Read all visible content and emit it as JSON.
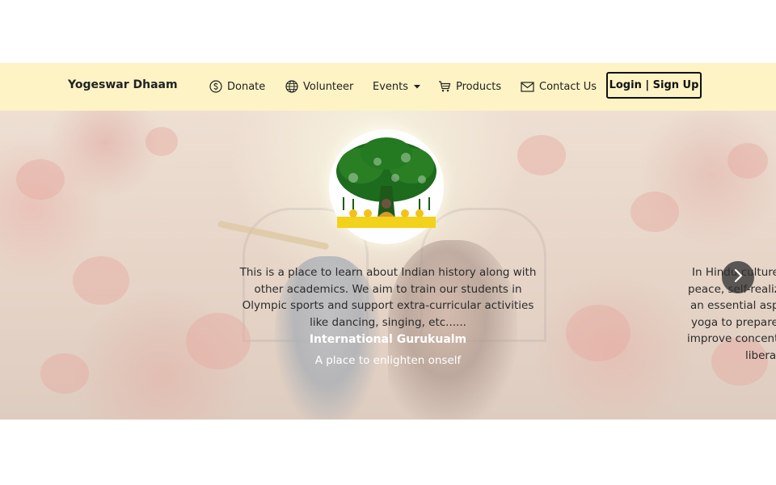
{
  "brand": {
    "name": "Yogeswar Dhaam"
  },
  "nav": {
    "items": [
      {
        "label": "Donate",
        "icon": "dollar-circle-icon"
      },
      {
        "label": "Volunteer",
        "icon": "globe-icon"
      },
      {
        "label": "Events",
        "icon": "caret-down-icon"
      },
      {
        "label": "Products",
        "icon": "cart-icon"
      },
      {
        "label": "Contact Us",
        "icon": "envelope-icon"
      }
    ],
    "login_label": "Login | Sign Up"
  },
  "hero": {
    "slides": [
      {
        "text": "This is a place to learn about Indian history along with other academics. We aim to train our students in Olympic sports and support extra-curricular activities like dancing, singing, etc......",
        "title": "International Gurukualm",
        "subtitle": "A place to enlighten onself"
      }
    ],
    "next_slide_lines": [
      "In Hindu culture, r",
      "peace, self-realizati",
      "an essential aspec",
      "yoga to prepare th",
      "improve concentrat",
      "liberat"
    ],
    "next_button_icon": "chevron-right-icon"
  },
  "colors": {
    "navbar_bg": "#fdf3c5",
    "logo_tree": "#1d6b1d",
    "text": "#222222"
  }
}
